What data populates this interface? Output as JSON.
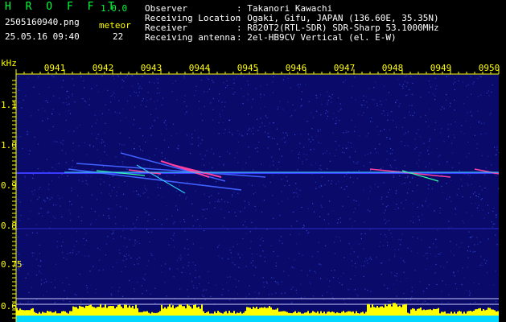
{
  "header": {
    "app_name": "H R O F F T",
    "version": "1.0.0",
    "filename": "2505160940.png",
    "datetime": "25.05.16 09:40",
    "meteor_label": "meteor",
    "meteor_count": "22",
    "fields": [
      {
        "label": "Observer",
        "value": ": Takanori Kawachi"
      },
      {
        "label": "Receiving Location",
        "value": ": Ogaki, Gifu, JAPAN (136.60E, 35.35N)"
      },
      {
        "label": "Receiver",
        "value": ": R820T2(RTL-SDR) SDR-Sharp 53.1000MHz"
      },
      {
        "label": "Receiving antenna",
        "value": ": 2el-HB9CV Vertical (el. E-W)"
      }
    ]
  },
  "spectrogram": {
    "y_unit": "kHz",
    "x_ticks": [
      "0941",
      "0942",
      "0943",
      "0944",
      "0945",
      "0946",
      "0947",
      "0948",
      "0949",
      "0950"
    ],
    "y_ticks": [
      "1.1",
      "1.0",
      "0.9",
      "0.8",
      "0.75",
      "0.6"
    ],
    "colors": {
      "background": "#0a0a6a",
      "noise": "#4060ff",
      "signal": "#ff40a0",
      "activity": "#ffff00",
      "baseline": "#00d8ff",
      "axis": "#ffff00"
    }
  }
}
